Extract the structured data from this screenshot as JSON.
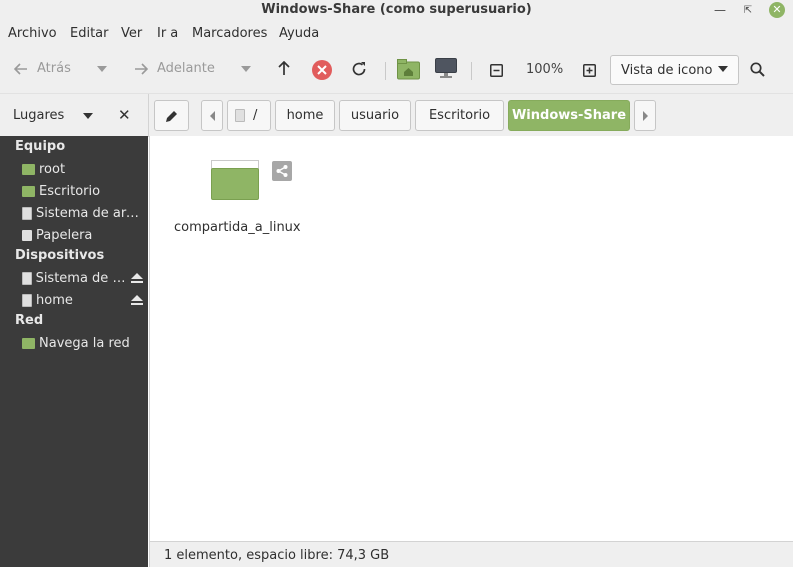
{
  "window": {
    "title": "Windows-Share (como superusuario)"
  },
  "menubar": {
    "items": [
      "Archivo",
      "Editar",
      "Ver",
      "Ir a",
      "Marcadores",
      "Ayuda"
    ]
  },
  "toolbar": {
    "back_label": "Atrás",
    "forward_label": "Adelante",
    "zoom_level": "100%",
    "view_mode": "Vista de icono",
    "icons": {
      "back": "arrow-left-icon",
      "forward": "arrow-right-icon",
      "up": "arrow-up-icon",
      "stop": "stop-icon",
      "reload": "reload-icon",
      "home": "home-folder-icon",
      "computer": "computer-icon",
      "zoom_out": "zoom-out-icon",
      "zoom_in": "zoom-in-icon",
      "search": "search-icon"
    }
  },
  "places": {
    "header_label": "Lugares"
  },
  "breadcrumb": {
    "root_label": "/",
    "items": [
      "home",
      "usuario",
      "Escritorio",
      "Windows-Share"
    ]
  },
  "sidebar": {
    "sections": [
      {
        "title": "Equipo",
        "items": [
          {
            "label": "root",
            "icon": "home-folder-icon"
          },
          {
            "label": "Escritorio",
            "icon": "desktop-folder-icon"
          },
          {
            "label": "Sistema de arc…",
            "icon": "drive-icon"
          },
          {
            "label": "Papelera",
            "icon": "trash-icon"
          }
        ]
      },
      {
        "title": "Dispositivos",
        "items": [
          {
            "label": "Sistema de a…",
            "icon": "drive-icon",
            "ejectable": true
          },
          {
            "label": "home",
            "icon": "drive-icon",
            "ejectable": true
          }
        ]
      },
      {
        "title": "Red",
        "items": [
          {
            "label": "Navega la red",
            "icon": "network-folder-icon"
          }
        ]
      }
    ]
  },
  "main": {
    "files": [
      {
        "name": "compartida_a_linux",
        "icon": "folder-icon",
        "emblem": "share-icon"
      }
    ]
  },
  "statusbar": {
    "text": "1 elemento, espacio libre: 74,3 GB"
  },
  "colors": {
    "accent": "#8fb565",
    "sidebar_bg": "#3b3b3b",
    "chrome_bg": "#efefef",
    "stop_red": "#e15c5c"
  }
}
